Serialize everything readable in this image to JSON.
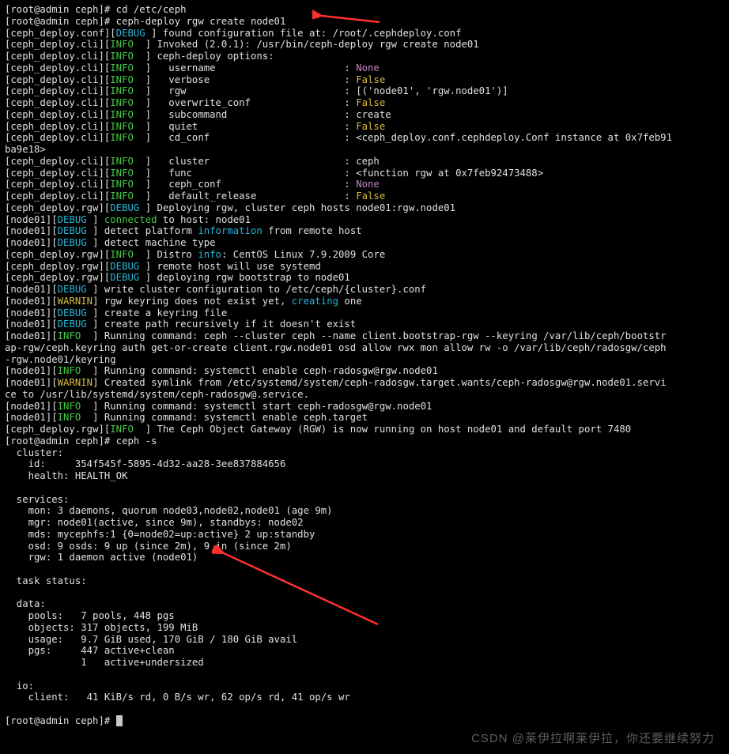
{
  "lines": [
    {
      "seg": [
        [
          "w",
          "[root@admin ceph]# "
        ],
        [
          "w",
          "cd /etc/ceph"
        ]
      ]
    },
    {
      "seg": [
        [
          "w",
          "[root@admin ceph]# "
        ],
        [
          "w",
          "ceph-deploy rgw create node01"
        ]
      ]
    },
    {
      "seg": [
        [
          "w",
          "[ceph_deploy.conf]["
        ],
        [
          "c",
          "DEBUG "
        ],
        [
          "w",
          "] found configuration file at: /root/.cephdeploy.conf"
        ]
      ]
    },
    {
      "seg": [
        [
          "w",
          "[ceph_deploy.cli]["
        ],
        [
          "g",
          "INFO  "
        ],
        [
          "w",
          "] Invoked (2.0.1): /usr/bin/ceph-deploy rgw create node01"
        ]
      ]
    },
    {
      "seg": [
        [
          "w",
          "[ceph_deploy.cli]["
        ],
        [
          "g",
          "INFO  "
        ],
        [
          "w",
          "] ceph-deploy options:"
        ]
      ]
    },
    {
      "seg": [
        [
          "w",
          "[ceph_deploy.cli]["
        ],
        [
          "g",
          "INFO  "
        ],
        [
          "w",
          "]   username                      : "
        ],
        [
          "m",
          "None"
        ]
      ]
    },
    {
      "seg": [
        [
          "w",
          "[ceph_deploy.cli]["
        ],
        [
          "g",
          "INFO  "
        ],
        [
          "w",
          "]   verbose                       : "
        ],
        [
          "y",
          "False"
        ]
      ]
    },
    {
      "seg": [
        [
          "w",
          "[ceph_deploy.cli]["
        ],
        [
          "g",
          "INFO  "
        ],
        [
          "w",
          "]   rgw                           : [('node01', 'rgw.node01')]"
        ]
      ]
    },
    {
      "seg": [
        [
          "w",
          "[ceph_deploy.cli]["
        ],
        [
          "g",
          "INFO  "
        ],
        [
          "w",
          "]   overwrite_conf                : "
        ],
        [
          "y",
          "False"
        ]
      ]
    },
    {
      "seg": [
        [
          "w",
          "[ceph_deploy.cli]["
        ],
        [
          "g",
          "INFO  "
        ],
        [
          "w",
          "]   subcommand                    : create"
        ]
      ]
    },
    {
      "seg": [
        [
          "w",
          "[ceph_deploy.cli]["
        ],
        [
          "g",
          "INFO  "
        ],
        [
          "w",
          "]   quiet                         : "
        ],
        [
          "y",
          "False"
        ]
      ]
    },
    {
      "seg": [
        [
          "w",
          "[ceph_deploy.cli]["
        ],
        [
          "g",
          "INFO  "
        ],
        [
          "w",
          "]   cd_conf                       : <ceph_deploy.conf.cephdeploy.Conf instance at 0x7feb91"
        ]
      ]
    },
    {
      "seg": [
        [
          "w",
          "ba9e18>"
        ]
      ]
    },
    {
      "seg": [
        [
          "w",
          "[ceph_deploy.cli]["
        ],
        [
          "g",
          "INFO  "
        ],
        [
          "w",
          "]   cluster                       : ceph"
        ]
      ]
    },
    {
      "seg": [
        [
          "w",
          "[ceph_deploy.cli]["
        ],
        [
          "g",
          "INFO  "
        ],
        [
          "w",
          "]   func                          : <function rgw at 0x7feb92473488>"
        ]
      ]
    },
    {
      "seg": [
        [
          "w",
          "[ceph_deploy.cli]["
        ],
        [
          "g",
          "INFO  "
        ],
        [
          "w",
          "]   ceph_conf                     : "
        ],
        [
          "m",
          "None"
        ]
      ]
    },
    {
      "seg": [
        [
          "w",
          "[ceph_deploy.cli]["
        ],
        [
          "g",
          "INFO  "
        ],
        [
          "w",
          "]   default_release               : "
        ],
        [
          "y",
          "False"
        ]
      ]
    },
    {
      "seg": [
        [
          "w",
          "[ceph_deploy.rgw]["
        ],
        [
          "c",
          "DEBUG "
        ],
        [
          "w",
          "] Deploying rgw, cluster ceph hosts node01:rgw.node01"
        ]
      ]
    },
    {
      "seg": [
        [
          "w",
          "[node01]["
        ],
        [
          "c",
          "DEBUG "
        ],
        [
          "w",
          "] "
        ],
        [
          "g",
          "connected"
        ],
        [
          "w",
          " to host: node01"
        ]
      ]
    },
    {
      "seg": [
        [
          "w",
          "[node01]["
        ],
        [
          "c",
          "DEBUG "
        ],
        [
          "w",
          "] detect platform "
        ],
        [
          "c",
          "information"
        ],
        [
          "w",
          " from remote host"
        ]
      ]
    },
    {
      "seg": [
        [
          "w",
          "[node01]["
        ],
        [
          "c",
          "DEBUG "
        ],
        [
          "w",
          "] detect machine type"
        ]
      ]
    },
    {
      "seg": [
        [
          "w",
          "[ceph_deploy.rgw]["
        ],
        [
          "g",
          "INFO  "
        ],
        [
          "w",
          "] Distro "
        ],
        [
          "c",
          "info"
        ],
        [
          "w",
          ": CentOS Linux 7.9.2009 Core"
        ]
      ]
    },
    {
      "seg": [
        [
          "w",
          "[ceph_deploy.rgw]["
        ],
        [
          "c",
          "DEBUG "
        ],
        [
          "w",
          "] remote host will use systemd"
        ]
      ]
    },
    {
      "seg": [
        [
          "w",
          "[ceph_deploy.rgw]["
        ],
        [
          "c",
          "DEBUG "
        ],
        [
          "w",
          "] deploying rgw bootstrap to node01"
        ]
      ]
    },
    {
      "seg": [
        [
          "w",
          "[node01]["
        ],
        [
          "c",
          "DEBUG "
        ],
        [
          "w",
          "] write cluster configuration to /etc/ceph/{cluster}.conf"
        ]
      ]
    },
    {
      "seg": [
        [
          "w",
          "[node01]["
        ],
        [
          "y",
          "WARNIN"
        ],
        [
          "w",
          "] rgw keyring does not exist yet, "
        ],
        [
          "c",
          "creating"
        ],
        [
          "w",
          " one"
        ]
      ]
    },
    {
      "seg": [
        [
          "w",
          "[node01]["
        ],
        [
          "c",
          "DEBUG "
        ],
        [
          "w",
          "] create a keyring file"
        ]
      ]
    },
    {
      "seg": [
        [
          "w",
          "[node01]["
        ],
        [
          "c",
          "DEBUG "
        ],
        [
          "w",
          "] create path recursively if it doesn't exist"
        ]
      ]
    },
    {
      "seg": [
        [
          "w",
          "[node01]["
        ],
        [
          "g",
          "INFO  "
        ],
        [
          "w",
          "] Running command: ceph --cluster ceph --name client.bootstrap-rgw --keyring /var/lib/ceph/bootstr"
        ]
      ]
    },
    {
      "seg": [
        [
          "w",
          "ap-rgw/ceph.keyring auth get-or-create client.rgw.node01 osd allow rwx mon allow rw -o /var/lib/ceph/radosgw/ceph"
        ]
      ]
    },
    {
      "seg": [
        [
          "w",
          "-rgw.node01/keyring"
        ]
      ]
    },
    {
      "seg": [
        [
          "w",
          "[node01]["
        ],
        [
          "g",
          "INFO  "
        ],
        [
          "w",
          "] Running command: systemctl enable ceph-radosgw@rgw.node01"
        ]
      ]
    },
    {
      "seg": [
        [
          "w",
          "[node01]["
        ],
        [
          "y",
          "WARNIN"
        ],
        [
          "w",
          "] Created symlink from /etc/systemd/system/ceph-radosgw.target.wants/ceph-radosgw@rgw.node01.servi"
        ]
      ]
    },
    {
      "seg": [
        [
          "w",
          "ce to /usr/lib/systemd/system/ceph-radosgw@.service."
        ]
      ]
    },
    {
      "seg": [
        [
          "w",
          "[node01]["
        ],
        [
          "g",
          "INFO  "
        ],
        [
          "w",
          "] Running command: systemctl start ceph-radosgw@rgw.node01"
        ]
      ]
    },
    {
      "seg": [
        [
          "w",
          "[node01]["
        ],
        [
          "g",
          "INFO  "
        ],
        [
          "w",
          "] Running command: systemctl enable ceph.target"
        ]
      ]
    },
    {
      "seg": [
        [
          "w",
          "[ceph_deploy.rgw]["
        ],
        [
          "g",
          "INFO  "
        ],
        [
          "w",
          "] The Ceph Object Gateway (RGW) is now running on host node01 and default port 7480"
        ]
      ]
    },
    {
      "seg": [
        [
          "w",
          "[root@admin ceph]# ceph -s"
        ]
      ]
    },
    {
      "seg": [
        [
          "w",
          "  cluster:"
        ]
      ]
    },
    {
      "seg": [
        [
          "w",
          "    id:     354f545f-5895-4d32-aa28-3ee837884656"
        ]
      ]
    },
    {
      "seg": [
        [
          "w",
          "    health: HEALTH_OK"
        ]
      ]
    },
    {
      "seg": [
        [
          "w",
          " "
        ]
      ]
    },
    {
      "seg": [
        [
          "w",
          "  services:"
        ]
      ]
    },
    {
      "seg": [
        [
          "w",
          "    mon: 3 daemons, quorum node03,node02,node01 (age 9m)"
        ]
      ]
    },
    {
      "seg": [
        [
          "w",
          "    mgr: node01(active, since 9m), standbys: node02"
        ]
      ]
    },
    {
      "seg": [
        [
          "w",
          "    mds: mycephfs:1 {0=node02=up:active} 2 up:standby"
        ]
      ]
    },
    {
      "seg": [
        [
          "w",
          "    osd: 9 osds: 9 up (since 2m), 9 in (since 2m)"
        ]
      ]
    },
    {
      "seg": [
        [
          "w",
          "    rgw: 1 daemon active (node01)"
        ]
      ]
    },
    {
      "seg": [
        [
          "w",
          " "
        ]
      ]
    },
    {
      "seg": [
        [
          "w",
          "  task status:"
        ]
      ]
    },
    {
      "seg": [
        [
          "w",
          " "
        ]
      ]
    },
    {
      "seg": [
        [
          "w",
          "  data:"
        ]
      ]
    },
    {
      "seg": [
        [
          "w",
          "    pools:   7 pools, 448 pgs"
        ]
      ]
    },
    {
      "seg": [
        [
          "w",
          "    objects: 317 objects, 199 MiB"
        ]
      ]
    },
    {
      "seg": [
        [
          "w",
          "    usage:   9.7 GiB used, 170 GiB / 180 GiB avail"
        ]
      ]
    },
    {
      "seg": [
        [
          "w",
          "    pgs:     447 active+clean"
        ]
      ]
    },
    {
      "seg": [
        [
          "w",
          "             1   active+undersized"
        ]
      ]
    },
    {
      "seg": [
        [
          "w",
          " "
        ]
      ]
    },
    {
      "seg": [
        [
          "w",
          "  io:"
        ]
      ]
    },
    {
      "seg": [
        [
          "w",
          "    client:   41 KiB/s rd, 0 B/s wr, 62 op/s rd, 41 op/s wr"
        ]
      ]
    },
    {
      "seg": [
        [
          "w",
          " "
        ]
      ]
    },
    {
      "seg": [
        [
          "w",
          "[root@admin ceph]# "
        ]
      ],
      "cursor": true
    }
  ],
  "watermark": "CSDN @莱伊拉啊莱伊拉，你还要继续努力"
}
